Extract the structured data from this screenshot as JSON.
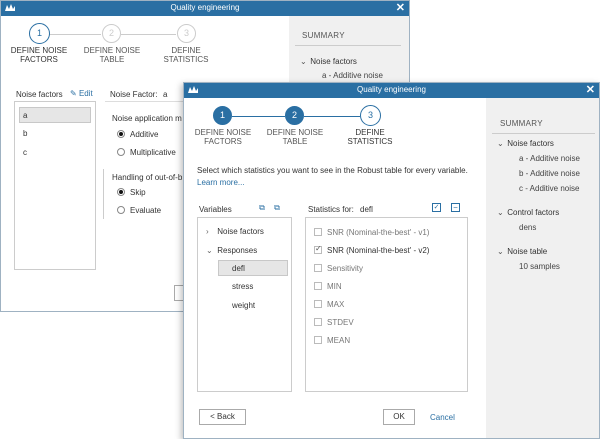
{
  "back_window": {
    "title": "Quality engineering",
    "steps": [
      {
        "num": "1",
        "label_line1": "DEFINE NOISE",
        "label_line2": "FACTORS"
      },
      {
        "num": "2",
        "label_line1": "DEFINE NOISE",
        "label_line2": "TABLE"
      },
      {
        "num": "3",
        "label_line1": "DEFINE",
        "label_line2": "STATISTICS"
      }
    ],
    "noise_factors_label": "Noise factors",
    "edit_label": "Edit",
    "noise_factors": [
      "a",
      "b",
      "c"
    ],
    "noise_factor_prefix": "Noise Factor:",
    "noise_factor_selected": "a",
    "noise_application_label": "Noise application m",
    "options_application": [
      "Additive",
      "Multiplicative"
    ],
    "out_of_bounds_label": "Handling of out-of-b",
    "options_out_of_bounds": [
      "Skip",
      "Evaluate"
    ],
    "summary_title": "SUMMARY",
    "summary_noise_factors": "Noise factors",
    "summary_noise_item": "a - Additive noise"
  },
  "front_window": {
    "title": "Quality engineering",
    "steps": [
      {
        "num": "1",
        "label_line1": "DEFINE NOISE",
        "label_line2": "FACTORS"
      },
      {
        "num": "2",
        "label_line1": "DEFINE NOISE",
        "label_line2": "TABLE"
      },
      {
        "num": "3",
        "label_line1": "DEFINE",
        "label_line2": "STATISTICS"
      }
    ],
    "instruction": "Select which statistics you want to see in the Robust table for every variable.",
    "learn_more": "Learn more...",
    "variables_label": "Variables",
    "tree": {
      "noise_factors": "Noise factors",
      "responses": "Responses",
      "responses_children": [
        "defl",
        "stress",
        "weight"
      ]
    },
    "statistics_for_label": "Statistics for:",
    "statistics_for_value": "defl",
    "statistics": [
      {
        "label": "SNR (Nominal-the-best' - v1)",
        "checked": false
      },
      {
        "label": "SNR (Nominal-the-best' - v2)",
        "checked": true
      },
      {
        "label": "Sensitivity",
        "checked": false
      },
      {
        "label": "MIN",
        "checked": false
      },
      {
        "label": "MAX",
        "checked": false
      },
      {
        "label": "STDEV",
        "checked": false
      },
      {
        "label": "MEAN",
        "checked": false
      }
    ],
    "back_button": "< Back",
    "ok_button": "OK",
    "cancel_button": "Cancel",
    "summary": {
      "title": "SUMMARY",
      "noise_factors_heading": "Noise factors",
      "noise_items": [
        "a - Additive noise",
        "b - Additive noise",
        "c - Additive noise"
      ],
      "control_factors_heading": "Control factors",
      "control_items": [
        "dens"
      ],
      "noise_table_heading": "Noise table",
      "noise_table_items": [
        "10 samples"
      ]
    }
  },
  "colors": {
    "accent": "#2a6fa3",
    "summary_bg": "#f0f0f0",
    "selected_bg": "#e6e6e6"
  }
}
